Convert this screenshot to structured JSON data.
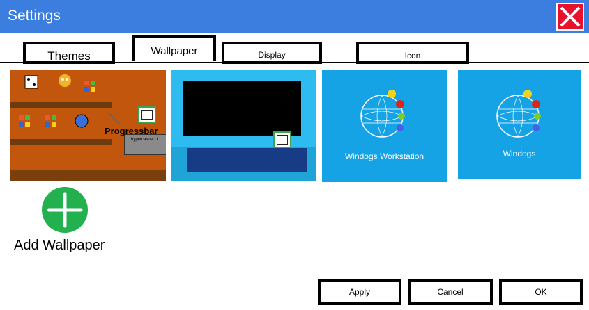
{
  "window": {
    "title": "Settings"
  },
  "tabs": [
    {
      "label": "Themes",
      "active": false
    },
    {
      "label": "Wallpaper",
      "active": true
    },
    {
      "label": "Display",
      "active": false
    },
    {
      "label": "Icon",
      "active": false
    }
  ],
  "wallpapers": [
    {
      "name": "progressbar-shelf-wallpaper",
      "progressbar_text": "Progressbar",
      "subtext": "hypercasual U"
    },
    {
      "name": "blue-desktop-wallpaper"
    },
    {
      "name": "windogs-workstation-wallpaper",
      "logo_text": "Windogs Workstation"
    },
    {
      "name": "windogs-wallpaper",
      "logo_text": "Windogs"
    }
  ],
  "add_wallpaper": {
    "label": "Add Wallpaper",
    "icon": "plus-icon"
  },
  "buttons": {
    "apply": "Apply",
    "cancel": "Cancel",
    "ok": "OK"
  },
  "colors": {
    "titlebar": "#3b7ee0",
    "close": "#e8102a",
    "add": "#23b04e"
  }
}
